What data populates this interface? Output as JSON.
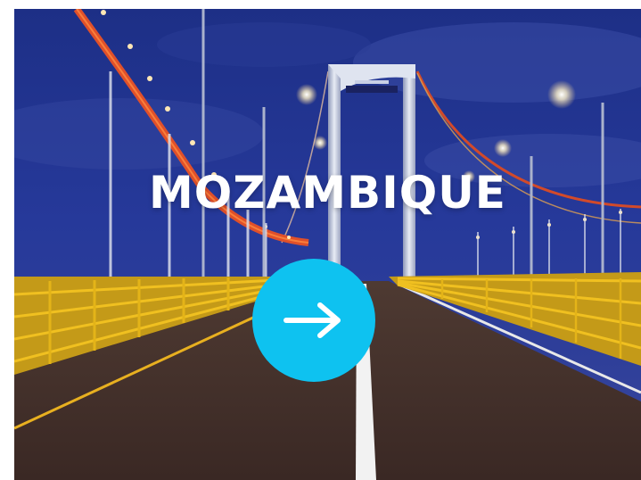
{
  "card": {
    "title": "MOZAMBIQUE",
    "button_icon": "arrow-right-icon",
    "accent_color": "#0ec2f0",
    "title_color": "#ffffff"
  }
}
